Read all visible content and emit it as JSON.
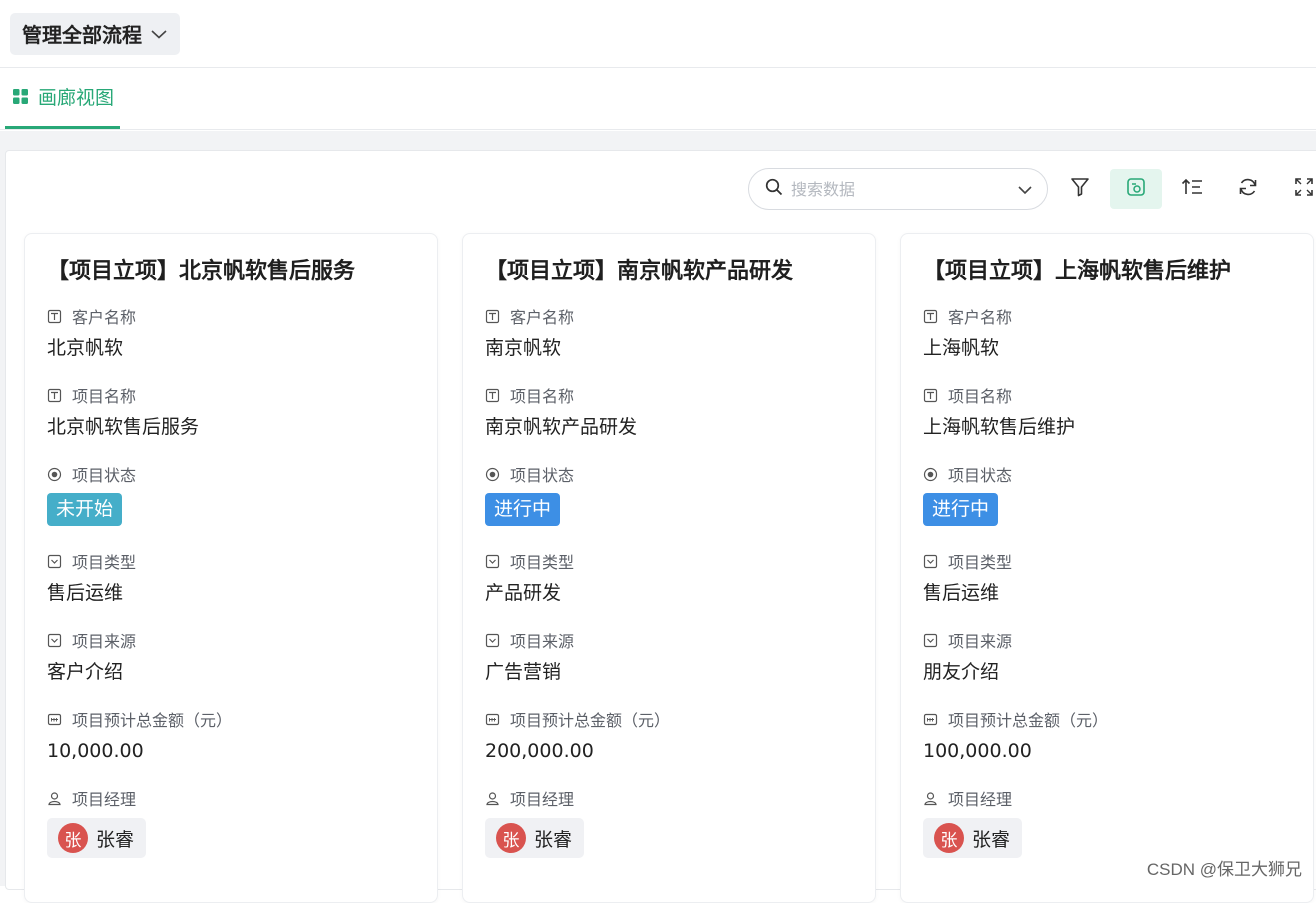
{
  "header": {
    "process_selector": "管理全部流程"
  },
  "tabs": [
    {
      "label": "画廊视图"
    }
  ],
  "toolbar": {
    "search_placeholder": "搜索数据",
    "search_value": ""
  },
  "field_labels": {
    "customer": "客户名称",
    "project": "项目名称",
    "status": "项目状态",
    "type": "项目类型",
    "source": "项目来源",
    "amount": "项目预计总金额（元）",
    "manager": "项目经理"
  },
  "cards": [
    {
      "title": "【项目立项】北京帆软售后服务",
      "customer": "北京帆软",
      "project": "北京帆软售后服务",
      "status": "未开始",
      "status_color": "#45aec9",
      "type": "售后运维",
      "source": "客户介绍",
      "amount": "10,000.00",
      "manager_avatar": "张",
      "manager": "张睿"
    },
    {
      "title": "【项目立项】南京帆软产品研发",
      "customer": "南京帆软",
      "project": "南京帆软产品研发",
      "status": "进行中",
      "status_color": "#3d8fe5",
      "type": "产品研发",
      "source": "广告营销",
      "amount": "200,000.00",
      "manager_avatar": "张",
      "manager": "张睿"
    },
    {
      "title": "【项目立项】上海帆软售后维护",
      "customer": "上海帆软",
      "project": "上海帆软售后维护",
      "status": "进行中",
      "status_color": "#3d8fe5",
      "type": "售后运维",
      "source": "朋友介绍",
      "amount": "100,000.00",
      "manager_avatar": "张",
      "manager": "张睿"
    }
  ],
  "watermark": "CSDN @保卫大狮兄",
  "colors": {
    "accent": "#28a877",
    "avatar": "#d9534f"
  }
}
